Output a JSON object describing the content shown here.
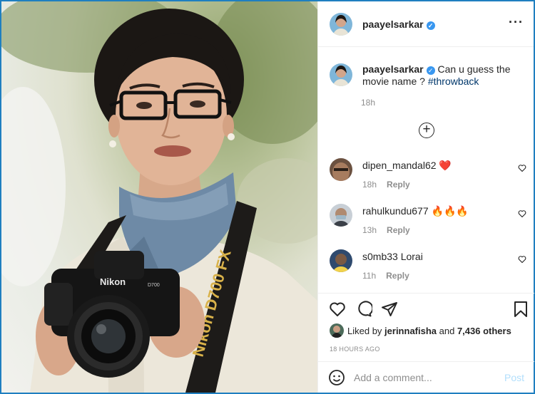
{
  "post": {
    "username": "paayelsarkar",
    "verified_badge": "verified-check-icon",
    "menu_icon": "more-options-icon",
    "caption_text": " Can u guess the movie name ? ",
    "caption_hashtag": "#throwback",
    "caption_time": "18h",
    "load_more_icon": "plus-circle-icon",
    "camera_brand": "Nikon",
    "camera_model": "D700",
    "strap_text": "Nikon D700 FX"
  },
  "comments": [
    {
      "user": "dipen_mandal62",
      "text": " ❤️",
      "time": "18h",
      "reply": "Reply"
    },
    {
      "user": "rahulkundu677",
      "text": " 🔥🔥🔥",
      "time": "13h",
      "reply": "Reply"
    },
    {
      "user": "s0mb33",
      "text": " Lorai",
      "time": "11h",
      "reply": "Reply"
    }
  ],
  "actions": {
    "likes_prefix": "Liked by ",
    "likes_user": "jerinnafisha",
    "likes_mid": " and ",
    "likes_count": "7,436 others",
    "posted_time": "18 HOURS AGO"
  },
  "add_comment": {
    "placeholder": "Add a comment...",
    "post_label": "Post"
  },
  "colors": {
    "border": "#1f7fc0",
    "verified": "#3897f0",
    "post_disabled": "#b2dffc",
    "hashtag": "#00376b",
    "muted": "#8e8e8e"
  }
}
